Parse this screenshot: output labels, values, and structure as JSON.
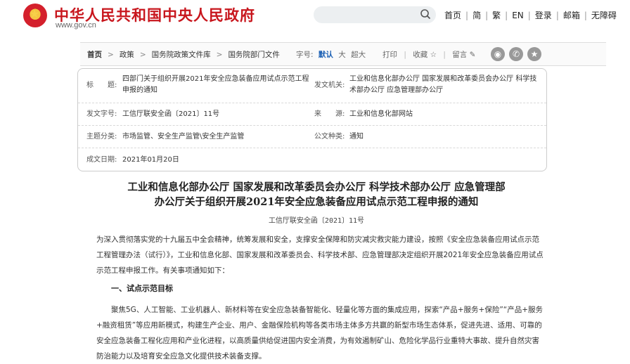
{
  "header": {
    "site_title": "中华人民共和国中央人民政府",
    "site_url": "www.gov.cn",
    "search_placeholder": "",
    "nav": [
      "首页",
      "简",
      "繁",
      "EN",
      "登录",
      "邮箱",
      "无障碍"
    ]
  },
  "breadcrumb": [
    "首页",
    "政策",
    "国务院政策文件库",
    "国务院部门文件"
  ],
  "font_size": {
    "label": "字号:",
    "options": [
      "默认",
      "大",
      "超大"
    ],
    "selected": "默认"
  },
  "tools": {
    "print": "打印",
    "favorite": "收藏",
    "comment": "留言"
  },
  "share_icons": [
    "weibo-icon",
    "wechat-icon",
    "star-icon"
  ],
  "meta": {
    "title_label": "标　　题:",
    "title_value": "四部门关于组织开展2021年安全应急装备应用试点示范工程申报的通知",
    "issuer_label": "发文机关:",
    "issuer_value": "工业和信息化部办公厅 国家发展和改革委员会办公厅 科学技术部办公厅 应急管理部办公厅",
    "docno_label": "发文字号:",
    "docno_value": "工信厅联安全函〔2021〕11号",
    "source_label": "来　　源:",
    "source_value": "工业和信息化部网站",
    "topic_label": "主题分类:",
    "topic_value": "市场监管、安全生产监管\\安全生产监管",
    "type_label": "公文种类:",
    "type_value": "通知",
    "date_label": "成文日期:",
    "date_value": "2021年01月20日"
  },
  "article": {
    "title_line1": "工业和信息化部办公厅 国家发展和改革委员会办公厅 科学技术部办公厅 应急管理部",
    "title_line2": "办公厅关于组织开展2021年安全应急装备应用试点示范工程申报的通知",
    "docno": "工信厅联安全函〔2021〕11号",
    "para1": "为深入贯彻落实党的十九届五中全会精神，统筹发展和安全，支撑安全保障和防灾减灾救灾能力建设，按照《安全应急装备应用试点示范工程管理办法（试行）》，工业和信息化部、国家发展和改革委员会、科学技术部、应急管理部决定组织开展2021年安全应急装备应用试点示范工程申报工作。有关事项通知如下：",
    "section1": "一、试点示范目标",
    "para2": "聚焦5G、人工智能、工业机器人、新材料等在安全应急装备智能化、轻量化等方面的集成应用，探索“产品+服务+保险”“产品+服务+融资租赁”等应用新模式，构建生产企业、用户、金融保险机构等各类市场主体多方共赢的新型市场生态体系，促进先进、适用、可靠的安全应急装备工程化应用和产业化进程，以高质量供给促进国内安全消费，为有效遏制矿山、危险化学品行业重特大事故、提升自然灾害防治能力以及培育安全应急文化提供技术装备支撑。"
  },
  "colors": {
    "brand_red": "#c8161d",
    "link_blue": "#1a5fb4"
  }
}
